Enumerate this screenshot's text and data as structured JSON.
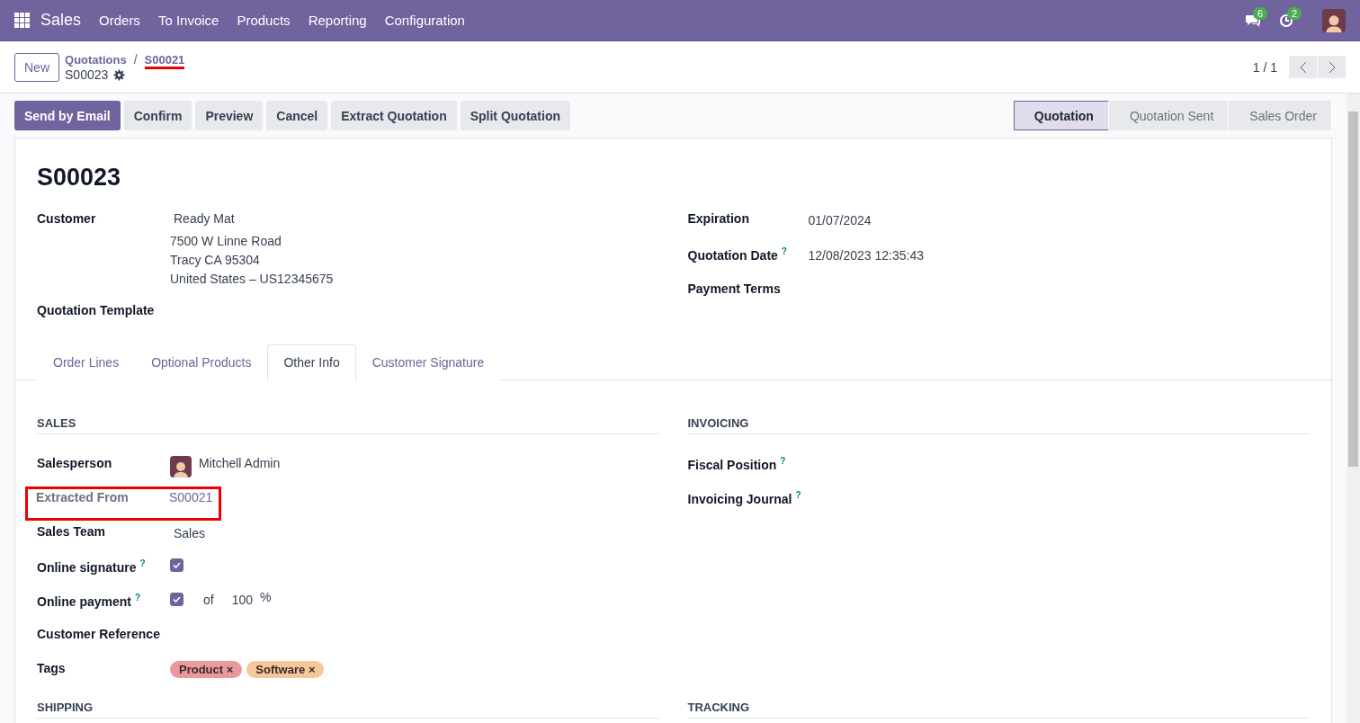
{
  "navbar": {
    "app": "Sales",
    "menu": [
      "Orders",
      "To Invoice",
      "Products",
      "Reporting",
      "Configuration"
    ],
    "notifications": [
      {
        "kind": "messages",
        "count": "6"
      },
      {
        "kind": "activities",
        "count": "2"
      }
    ]
  },
  "control_panel": {
    "new_button": "New",
    "breadcrumb": [
      {
        "label": "Quotations",
        "marked": false
      },
      {
        "label": "S00021",
        "marked": true
      }
    ],
    "separator": "/",
    "record": "S00023",
    "pager": "1 / 1"
  },
  "actions": [
    {
      "label": "Send by Email",
      "primary": true
    },
    {
      "label": "Confirm",
      "primary": false
    },
    {
      "label": "Preview",
      "primary": false
    },
    {
      "label": "Cancel",
      "primary": false
    },
    {
      "label": "Extract Quotation",
      "primary": false
    },
    {
      "label": "Split Quotation",
      "primary": false
    }
  ],
  "statusbar": [
    {
      "label": "Quotation",
      "selected": true
    },
    {
      "label": "Quotation Sent",
      "selected": false
    },
    {
      "label": "Sales Order",
      "selected": false
    }
  ],
  "title": "S00023",
  "fields_left": [
    {
      "label": "Customer",
      "lines": [
        "Ready Mat",
        "7500 W Linne Road",
        "Tracy CA 95304",
        "United States – US12345675"
      ]
    },
    {
      "label": "Quotation Template"
    }
  ],
  "fields_right": [
    {
      "label": "Expiration",
      "value": "01/07/2024"
    },
    {
      "label": "Quotation Date",
      "help": "?",
      "value": "12/08/2023 12:35:43"
    },
    {
      "label": "Payment Terms"
    }
  ],
  "tabs": [
    {
      "label": "Order Lines",
      "selected": false
    },
    {
      "label": "Optional Products",
      "selected": false
    },
    {
      "label": "Other Info",
      "selected": true
    },
    {
      "label": "Customer Signature",
      "selected": false
    }
  ],
  "sections": [
    {
      "title": "SALES",
      "fields": [
        {
          "kind": "person",
          "label": "Salesperson",
          "value": "Mitchell Admin"
        },
        {
          "kind": "link",
          "label": "Extracted From",
          "value": "S00021",
          "muted": true,
          "highlighted": true
        },
        {
          "kind": "text",
          "label": "Sales Team",
          "value": "Sales"
        },
        {
          "kind": "checkbox",
          "label": "Online signature",
          "help": "?",
          "checked": true
        },
        {
          "kind": "payment",
          "label": "Online payment",
          "help": "?",
          "checked": true,
          "of": "of",
          "amount": "100",
          "unit": "%"
        },
        {
          "kind": "empty",
          "label": "Customer Reference"
        },
        {
          "kind": "tags",
          "label": "Tags",
          "tags": [
            {
              "label": "Product",
              "color": "#ea9a9e"
            },
            {
              "label": "Software",
              "color": "#f6c79a"
            }
          ],
          "remove": "×"
        }
      ]
    },
    {
      "title": "INVOICING",
      "fields": [
        {
          "kind": "empty",
          "label": "Fiscal Position",
          "help": "?"
        },
        {
          "kind": "empty",
          "label": "Invoicing Journal",
          "help": "?"
        }
      ]
    }
  ],
  "next_sections": [
    "SHIPPING",
    "TRACKING"
  ]
}
